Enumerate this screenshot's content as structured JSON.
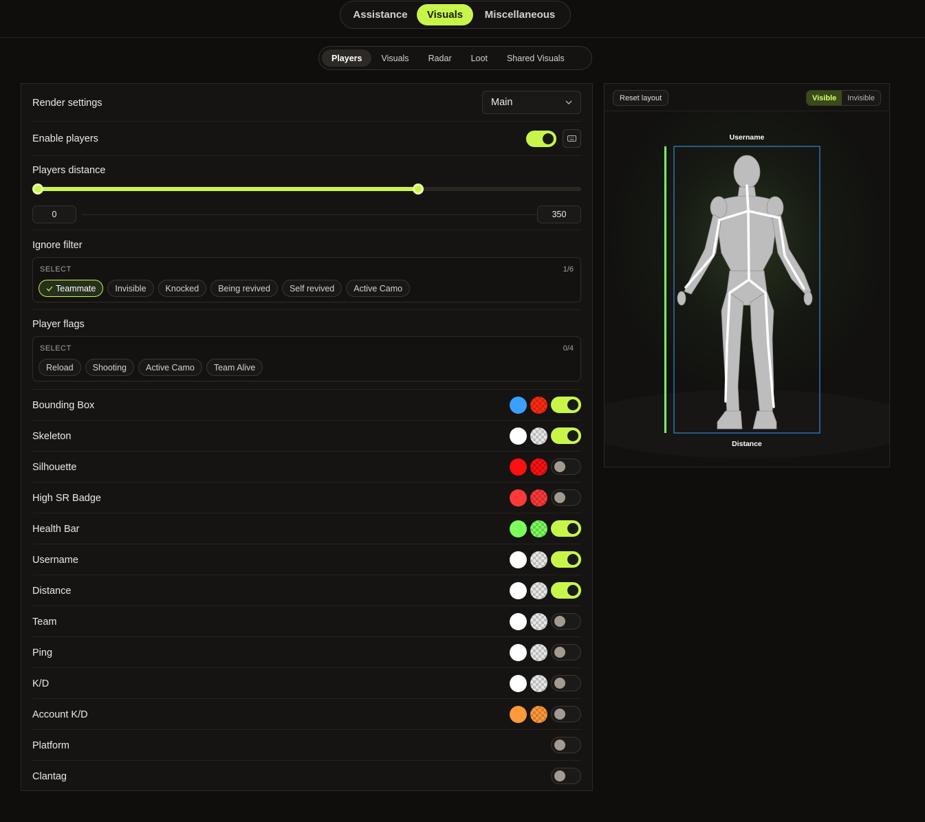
{
  "main_tabs": [
    {
      "label": "Assistance",
      "active": false
    },
    {
      "label": "Visuals",
      "active": true
    },
    {
      "label": "Miscellaneous",
      "active": false
    }
  ],
  "sub_tabs": [
    {
      "label": "Players",
      "active": true
    },
    {
      "label": "Visuals",
      "active": false
    },
    {
      "label": "Radar",
      "active": false
    },
    {
      "label": "Loot",
      "active": false
    },
    {
      "label": "Shared Visuals",
      "active": false
    }
  ],
  "render_settings": {
    "label": "Render settings",
    "selected": "Main"
  },
  "enable_players": {
    "label": "Enable players",
    "on": true
  },
  "players_distance": {
    "label": "Players distance",
    "min": "0",
    "max": "350",
    "fill_percent": 70
  },
  "ignore_filter": {
    "label": "Ignore filter",
    "select_label": "SELECT",
    "count": "1/6",
    "options": [
      {
        "label": "Teammate",
        "selected": true
      },
      {
        "label": "Invisible",
        "selected": false
      },
      {
        "label": "Knocked",
        "selected": false
      },
      {
        "label": "Being revived",
        "selected": false
      },
      {
        "label": "Self revived",
        "selected": false
      },
      {
        "label": "Active Camo",
        "selected": false
      }
    ]
  },
  "player_flags": {
    "label": "Player flags",
    "select_label": "SELECT",
    "count": "0/4",
    "options": [
      {
        "label": "Reload",
        "selected": false
      },
      {
        "label": "Shooting",
        "selected": false
      },
      {
        "label": "Active Camo",
        "selected": false
      },
      {
        "label": "Team Alive",
        "selected": false
      }
    ]
  },
  "features": [
    {
      "label": "Bounding Box",
      "color1": "#3aa0ff",
      "color2": "#ff2a10",
      "on": true
    },
    {
      "label": "Skeleton",
      "color1": "#ffffff",
      "color2": "#e6e6e6",
      "on": true
    },
    {
      "label": "Silhouette",
      "color1": "#ff1010",
      "color2": "#ff1010",
      "on": false
    },
    {
      "label": "High SR Badge",
      "color1": "#ff3838",
      "color2": "#ff3838",
      "on": false
    },
    {
      "label": "Health Bar",
      "color1": "#7cff5a",
      "color2": "#7cff5a",
      "on": true
    },
    {
      "label": "Username",
      "color1": "#ffffff",
      "color2": "#e6e6e6",
      "on": true
    },
    {
      "label": "Distance",
      "color1": "#ffffff",
      "color2": "#e6e6e6",
      "on": true
    },
    {
      "label": "Team",
      "color1": "#ffffff",
      "color2": "#e6e6e6",
      "on": false
    },
    {
      "label": "Ping",
      "color1": "#ffffff",
      "color2": "#e6e6e6",
      "on": false
    },
    {
      "label": "K/D",
      "color1": "#ffffff",
      "color2": "#e6e6e6",
      "on": false
    },
    {
      "label": "Account K/D",
      "color1": "#ff9a38",
      "color2": "#ff9a38",
      "on": false
    },
    {
      "label": "Platform",
      "color1": null,
      "color2": null,
      "on": false
    },
    {
      "label": "Clantag",
      "color1": null,
      "color2": null,
      "on": false
    }
  ],
  "preview": {
    "reset_label": "Reset layout",
    "visible_label": "Visible",
    "invisible_label": "Invisible",
    "username_label": "Username",
    "distance_label": "Distance",
    "box_color": "#3aa0ff",
    "healthbar_color": "#7cff5a"
  },
  "accent_color": "#c8f54a"
}
